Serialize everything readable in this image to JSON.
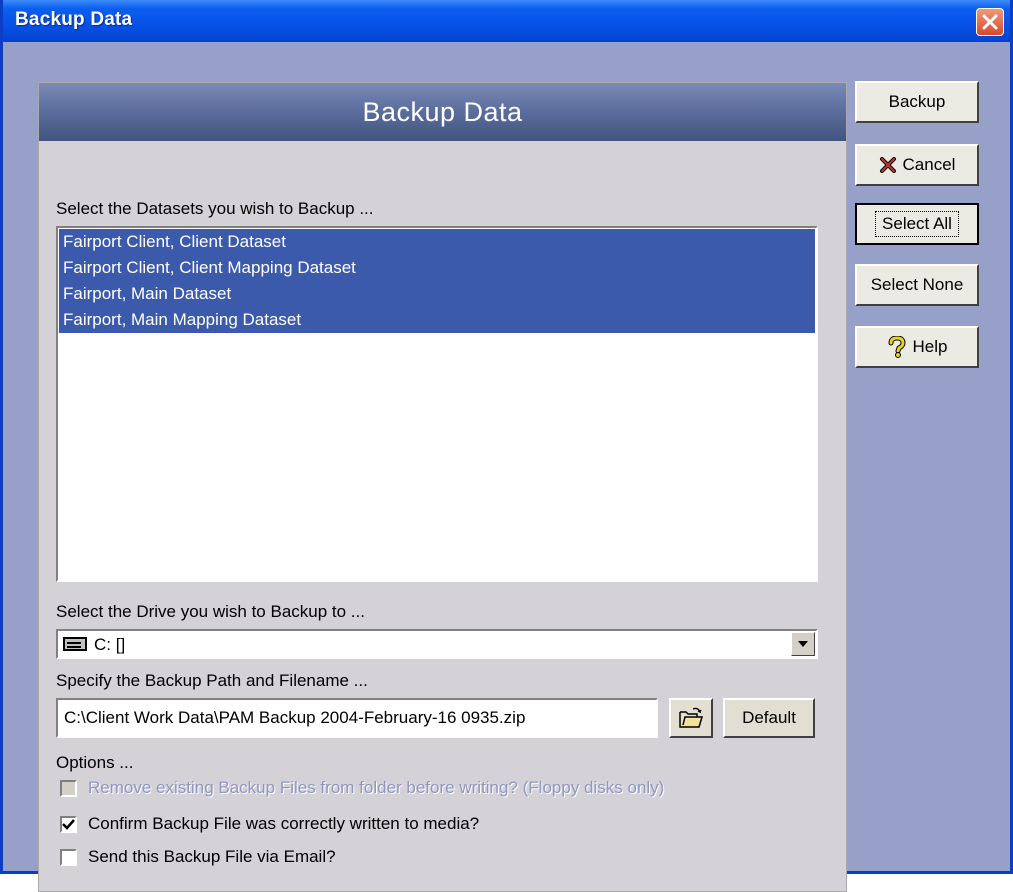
{
  "window": {
    "title": "Backup Data"
  },
  "panel": {
    "header": "Backup Data"
  },
  "datasets": {
    "label": "Select the Datasets you wish to Backup ...",
    "items": [
      "Fairport Client, Client Dataset",
      "Fairport Client, Client Mapping Dataset",
      "Fairport, Main Dataset",
      "Fairport, Main Mapping Dataset"
    ]
  },
  "drive": {
    "label": "Select the Drive you wish to Backup to ...",
    "value": "C: []"
  },
  "path": {
    "label": "Specify the Backup Path and Filename ...",
    "value": "C:\\Client Work Data\\PAM Backup 2004-February-16 0935.zip",
    "default_label": "Default"
  },
  "options": {
    "label": "Options ...",
    "remove_existing": {
      "label": "Remove existing Backup Files from folder before writing? (Floppy disks only)",
      "checked": false,
      "enabled": false
    },
    "confirm_written": {
      "label": "Confirm Backup File was correctly written to media?",
      "checked": true,
      "enabled": true
    },
    "send_email": {
      "label": "Send this Backup File via Email?",
      "checked": false,
      "enabled": true
    }
  },
  "buttons": {
    "backup": "Backup",
    "cancel": "Cancel",
    "select_all": "Select All",
    "select_none": "Select None",
    "help": "Help"
  },
  "colors": {
    "selection": "#3c5aac",
    "window_background": "#96a0c8",
    "panel_background": "#d4d2d6"
  },
  "icons": {
    "close": "close-x-icon",
    "cancel": "red-x-icon",
    "help": "question-mark-icon",
    "browse": "open-folder-icon",
    "drive": "drive-icon",
    "dropdown": "dropdown-arrow-icon"
  }
}
